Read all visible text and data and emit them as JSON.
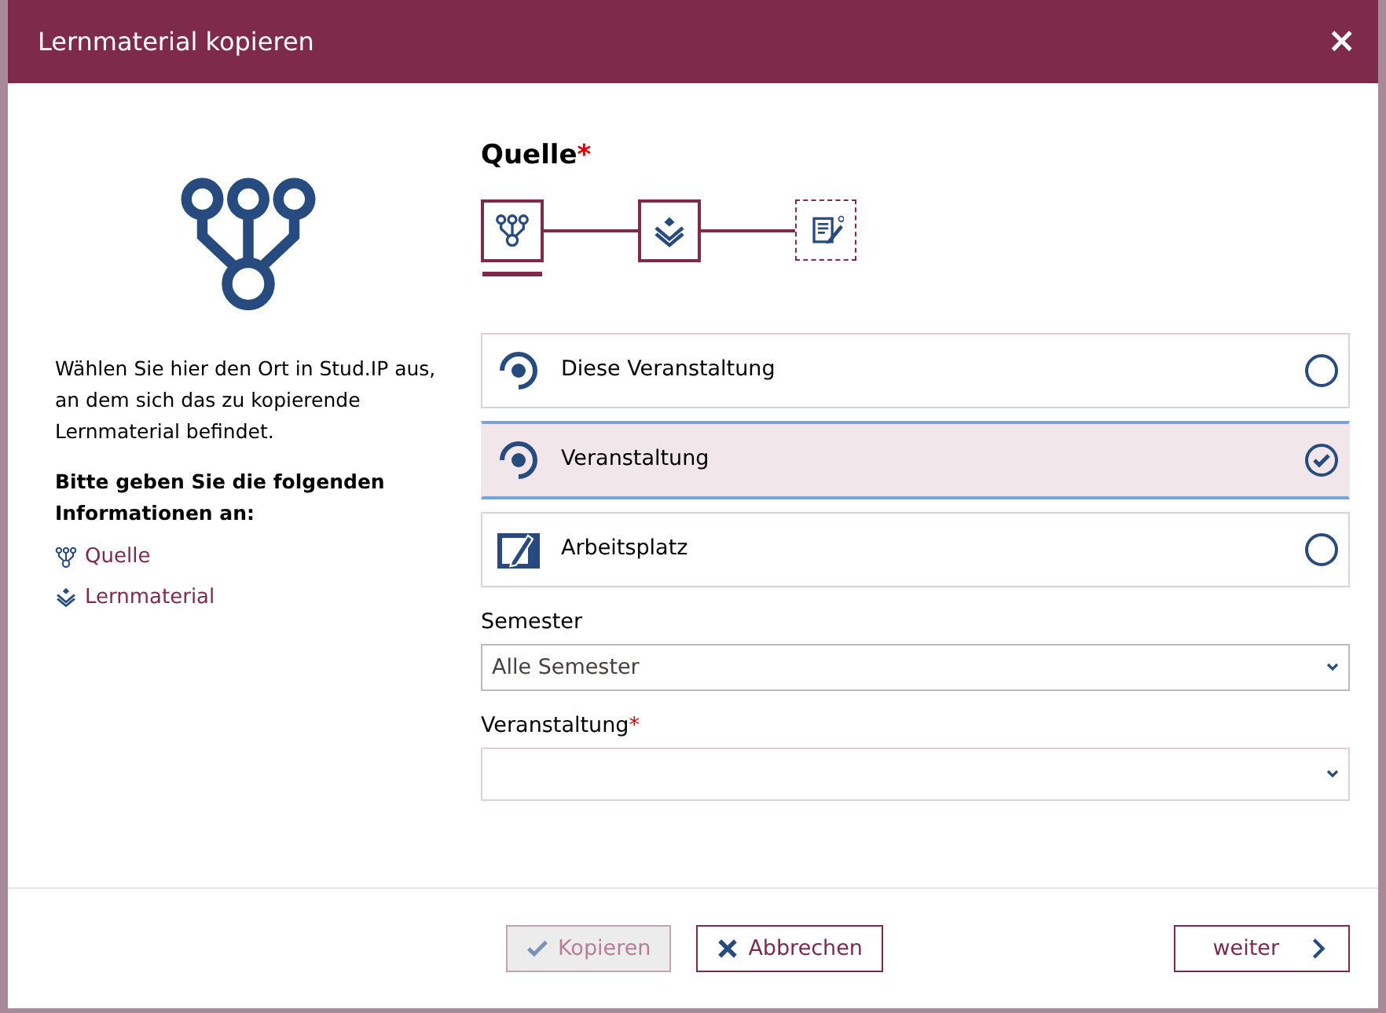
{
  "dialog": {
    "title": "Lernmaterial kopieren",
    "close": "×"
  },
  "sidebar": {
    "description": "Wählen Sie hier den Ort in Stud.IP aus, an dem sich das zu kopierende Lernmaterial befindet.",
    "info_heading": "Bitte geben Sie die folgenden Informationen an:",
    "links": [
      {
        "label": "Quelle",
        "kind": "source"
      },
      {
        "label": "Lernmaterial",
        "kind": "layers"
      }
    ]
  },
  "step_title": "Quelle",
  "step_required": "*",
  "steps": [
    {
      "kind": "source",
      "selected": true,
      "reachable": true
    },
    {
      "kind": "layers",
      "selected": false,
      "reachable": true
    },
    {
      "kind": "edit",
      "selected": false,
      "reachable": false
    }
  ],
  "options": [
    {
      "label": "Diese Veranstaltung",
      "kind": "course",
      "selected": false
    },
    {
      "label": "Veranstaltung",
      "kind": "course",
      "selected": true
    },
    {
      "label": "Arbeitsplatz",
      "kind": "workplace",
      "selected": false
    }
  ],
  "fields": [
    {
      "label": "Semester",
      "required": false,
      "value": "Alle Semester"
    },
    {
      "label": "Veranstaltung",
      "required": true
    }
  ],
  "buttons": [
    {
      "label": "Kopieren",
      "kind": "check",
      "disabled": true
    },
    {
      "label": "Abbrechen",
      "kind": "cancel",
      "disabled": false
    },
    {
      "label": "weiter",
      "kind": "next",
      "disabled": false
    }
  ]
}
